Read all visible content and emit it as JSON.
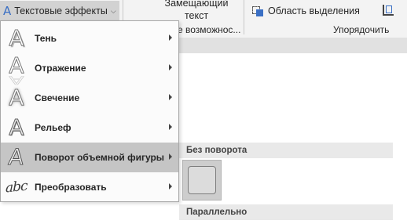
{
  "ribbon": {
    "text_effects_button": "Текстовые эффекты",
    "alt_text_line1": "Замещающий",
    "alt_text_line2": "текст",
    "accessibility_group": "е возможнос...",
    "selection_pane_button": "Область выделения",
    "arrange_group": "Упорядочить"
  },
  "menu": {
    "items": [
      {
        "label": "Тень",
        "icon": "shadow-a-icon"
      },
      {
        "label": "Отражение",
        "icon": "reflection-a-icon"
      },
      {
        "label": "Свечение",
        "icon": "glow-a-icon"
      },
      {
        "label": "Рельеф",
        "icon": "bevel-a-icon"
      },
      {
        "label": "Поворот объемной фигуры",
        "icon": "3d-rotation-a-icon",
        "active": true
      },
      {
        "label": "Преобразовать",
        "icon": "transform-abc-icon"
      }
    ]
  },
  "submenu": {
    "section1": "Без поворота",
    "section2": "Параллельно"
  },
  "colors": {
    "accent": "#3a6fc4",
    "active_item": "#c5c5c5",
    "ribbon_bg": "#f3f3f3"
  }
}
